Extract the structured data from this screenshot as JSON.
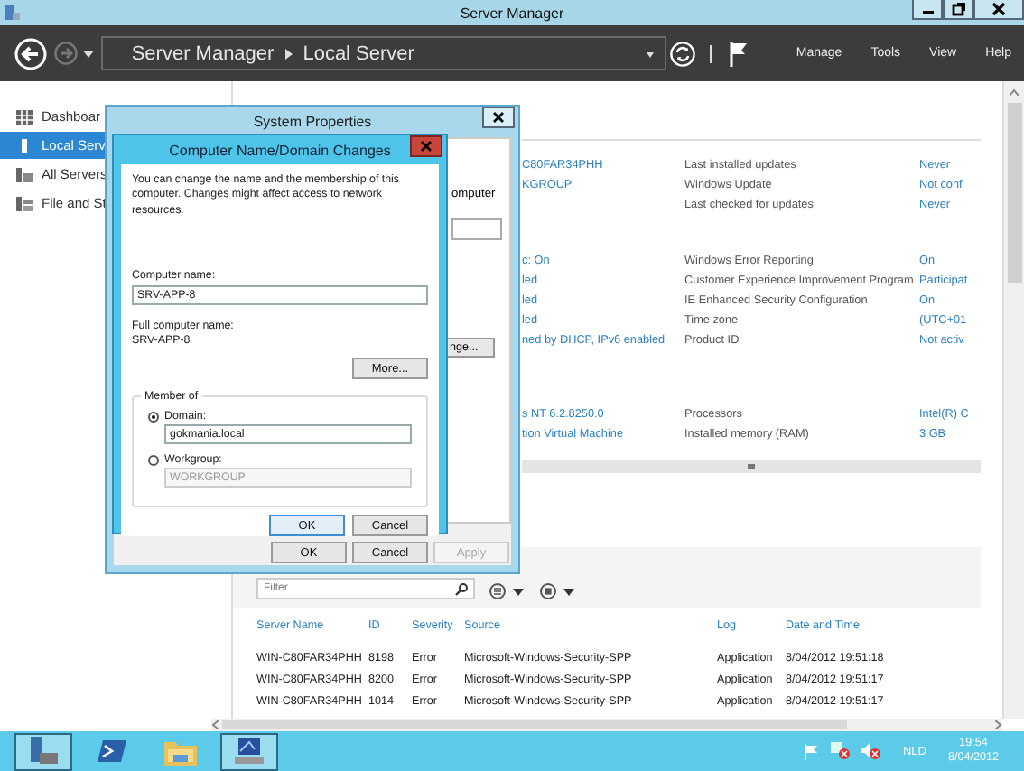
{
  "window": {
    "title": "Server Manager"
  },
  "toolbar": {
    "breadcrumb": [
      "Server Manager",
      "Local Server"
    ],
    "menus": [
      "Manage",
      "Tools",
      "View",
      "Help"
    ]
  },
  "sidebar": {
    "items": [
      {
        "kind": "dashboard",
        "label": "Dashboar",
        "selected": false
      },
      {
        "kind": "server",
        "label": "Local Serv",
        "selected": true
      },
      {
        "kind": "servers",
        "label": "All Servers",
        "selected": false
      },
      {
        "kind": "storage",
        "label": "File and St",
        "selected": false
      }
    ]
  },
  "properties": {
    "groups": [
      {
        "rows": [
          {
            "value": "C80FAR34PHH",
            "label": "Last installed updates",
            "setting": "Never"
          },
          {
            "value": "KGROUP",
            "label": "Windows Update",
            "setting": "Not conf"
          },
          {
            "label": "Last checked for updates",
            "setting": "Never"
          }
        ]
      },
      {
        "rows": [
          {
            "value": "c: On",
            "label": "Windows Error Reporting",
            "setting": "On"
          },
          {
            "value": "led",
            "label": "Customer Experience Improvement Program",
            "setting": "Participat"
          },
          {
            "value": "led",
            "label": "IE Enhanced Security Configuration",
            "setting": "On"
          },
          {
            "value": "led",
            "label": "Time zone",
            "setting": "(UTC+01"
          },
          {
            "value": "ned by DHCP, IPv6 enabled",
            "label": "Product ID",
            "setting": "Not activ"
          }
        ]
      },
      {
        "rows": [
          {
            "value": "s NT 6.2.8250.0",
            "label": "Processors",
            "setting": "Intel(R) C"
          },
          {
            "value": "tion Virtual Machine",
            "label": "Installed memory (RAM)",
            "setting": "3 GB"
          }
        ]
      }
    ]
  },
  "events": {
    "filter_placeholder": "Filter",
    "columns": [
      "Server Name",
      "ID",
      "Severity",
      "Source",
      "Log",
      "Date and Time"
    ],
    "rows": [
      [
        "WIN-C80FAR34PHH",
        "8198",
        "Error",
        "Microsoft-Windows-Security-SPP",
        "Application",
        "8/04/2012 19:51:18"
      ],
      [
        "WIN-C80FAR34PHH",
        "8200",
        "Error",
        "Microsoft-Windows-Security-SPP",
        "Application",
        "8/04/2012 19:51:17"
      ],
      [
        "WIN-C80FAR34PHH",
        "1014",
        "Error",
        "Microsoft-Windows-Security-SPP",
        "Application",
        "8/04/2012 19:51:17"
      ]
    ]
  },
  "system_properties": {
    "title": "System Properties",
    "partial_label": "omputer",
    "partial_button": "nge...",
    "buttons": [
      {
        "label": "OK",
        "disabled": false
      },
      {
        "label": "Cancel",
        "disabled": false
      },
      {
        "label": "Apply",
        "disabled": true
      }
    ]
  },
  "domain_dialog": {
    "title": "Computer Name/Domain Changes",
    "description": "You can change the name and the membership of this computer. Changes might affect access to network resources.",
    "computer_name_label": "Computer name:",
    "computer_name": "SRV-APP-8",
    "full_name_label": "Full computer name:",
    "full_name": "SRV-APP-8",
    "more_button": "More...",
    "member_of": {
      "label": "Member of",
      "options": [
        {
          "label": "Domain:",
          "selected": true,
          "value": "gokmania.local"
        },
        {
          "label": "Workgroup:",
          "selected": false,
          "value": "WORKGROUP"
        }
      ]
    },
    "buttons": [
      "OK",
      "Cancel"
    ]
  },
  "taskbar": {
    "apps": [
      {
        "kind": "server-manager",
        "selected": true
      },
      {
        "kind": "powershell",
        "selected": false
      },
      {
        "kind": "explorer",
        "selected": false
      },
      {
        "kind": "system",
        "selected": true
      }
    ],
    "language": "NLD",
    "time": "19:54",
    "date": "8/04/2012"
  }
}
